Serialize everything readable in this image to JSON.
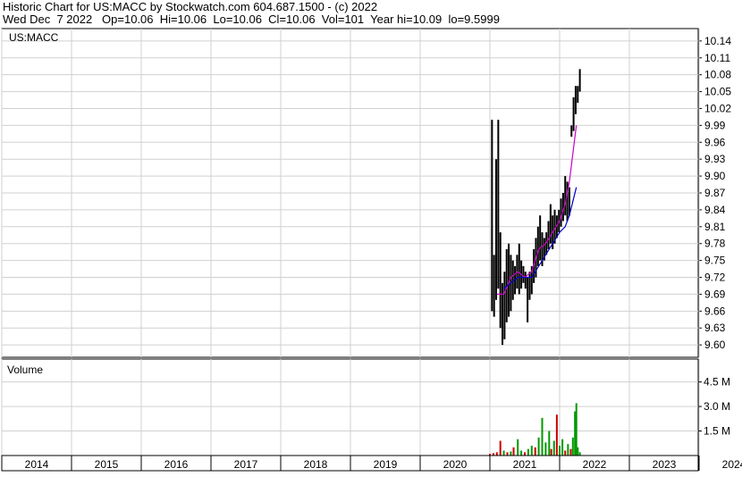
{
  "header": {
    "line1": "Historic Chart for US:MACC by Stockwatch.com 604.687.1500 - (c) 2022",
    "line2": "Wed Dec  7 2022   Op=10.06  Hi=10.06  Lo=10.06  Cl=10.06  Vol=101  Year hi=10.09  lo=9.5999"
  },
  "chart_data": [
    {
      "type": "candlestick",
      "title": "US:MACC",
      "y_ticks": [
        10.14,
        10.11,
        10.08,
        10.05,
        10.02,
        9.99,
        9.96,
        9.93,
        9.9,
        9.87,
        9.84,
        9.81,
        9.78,
        9.75,
        9.72,
        9.69,
        9.66,
        9.63,
        9.6
      ],
      "y_tick_labels": [
        "10.14",
        "10.11",
        "10.08",
        "10.05",
        "10.02",
        "9.99",
        "9.96",
        "9.93",
        "9.90",
        "9.87",
        "9.84",
        "9.81",
        "9.78",
        "9.75",
        "9.72",
        "9.69",
        "9.66",
        "9.63",
        "9.60"
      ],
      "ylim": [
        9.578,
        10.162
      ],
      "x_tick_labels": [
        "2014",
        "2015",
        "2016",
        "2017",
        "2018",
        "2019",
        "2020",
        "2021",
        "2022",
        "2023",
        "2024"
      ],
      "grid": true,
      "price_series": [
        {
          "t": 2021.03,
          "h": 10.0,
          "l": 9.66
        },
        {
          "t": 2021.06,
          "h": 9.76,
          "l": 9.65
        },
        {
          "t": 2021.09,
          "h": 9.93,
          "l": 9.68
        },
        {
          "t": 2021.12,
          "h": 10.0,
          "l": 9.7
        },
        {
          "t": 2021.15,
          "h": 9.8,
          "l": 9.63
        },
        {
          "t": 2021.18,
          "h": 9.71,
          "l": 9.6
        },
        {
          "t": 2021.21,
          "h": 9.73,
          "l": 9.61
        },
        {
          "t": 2021.24,
          "h": 9.77,
          "l": 9.64
        },
        {
          "t": 2021.27,
          "h": 9.78,
          "l": 9.65
        },
        {
          "t": 2021.3,
          "h": 9.76,
          "l": 9.66
        },
        {
          "t": 2021.33,
          "h": 9.75,
          "l": 9.68
        },
        {
          "t": 2021.36,
          "h": 9.74,
          "l": 9.69
        },
        {
          "t": 2021.39,
          "h": 9.76,
          "l": 9.7
        },
        {
          "t": 2021.42,
          "h": 9.78,
          "l": 9.69
        },
        {
          "t": 2021.45,
          "h": 9.75,
          "l": 9.7
        },
        {
          "t": 2021.48,
          "h": 9.74,
          "l": 9.71
        },
        {
          "t": 2021.51,
          "h": 9.73,
          "l": 9.7
        },
        {
          "t": 2021.54,
          "h": 9.72,
          "l": 9.64
        },
        {
          "t": 2021.57,
          "h": 9.73,
          "l": 9.68
        },
        {
          "t": 2021.6,
          "h": 9.74,
          "l": 9.69
        },
        {
          "t": 2021.63,
          "h": 9.77,
          "l": 9.71
        },
        {
          "t": 2021.66,
          "h": 9.79,
          "l": 9.72
        },
        {
          "t": 2021.69,
          "h": 9.81,
          "l": 9.74
        },
        {
          "t": 2021.72,
          "h": 9.83,
          "l": 9.75
        },
        {
          "t": 2021.75,
          "h": 9.8,
          "l": 9.74
        },
        {
          "t": 2021.78,
          "h": 9.79,
          "l": 9.75
        },
        {
          "t": 2021.81,
          "h": 9.8,
          "l": 9.76
        },
        {
          "t": 2021.84,
          "h": 9.82,
          "l": 9.77
        },
        {
          "t": 2021.87,
          "h": 9.85,
          "l": 9.78
        },
        {
          "t": 2021.9,
          "h": 9.83,
          "l": 9.77
        },
        {
          "t": 2021.93,
          "h": 9.84,
          "l": 9.78
        },
        {
          "t": 2021.96,
          "h": 9.83,
          "l": 9.79
        },
        {
          "t": 2021.99,
          "h": 9.84,
          "l": 9.8
        },
        {
          "t": 2022.02,
          "h": 9.86,
          "l": 9.81
        },
        {
          "t": 2022.05,
          "h": 9.87,
          "l": 9.82
        },
        {
          "t": 2022.08,
          "h": 9.9,
          "l": 9.83
        },
        {
          "t": 2022.11,
          "h": 9.89,
          "l": 9.82
        },
        {
          "t": 2022.14,
          "h": 9.88,
          "l": 9.83
        },
        {
          "t": 2022.17,
          "h": 9.99,
          "l": 9.97
        },
        {
          "t": 2022.2,
          "h": 10.04,
          "l": 9.98
        },
        {
          "t": 2022.23,
          "h": 10.06,
          "l": 10.01
        },
        {
          "t": 2022.26,
          "h": 10.06,
          "l": 10.03
        },
        {
          "t": 2022.29,
          "h": 10.09,
          "l": 10.05
        }
      ],
      "moving_averages": [
        {
          "color": "#cc00cc",
          "points": [
            [
              2021.1,
              9.69
            ],
            [
              2021.2,
              9.69
            ],
            [
              2021.3,
              9.72
            ],
            [
              2021.4,
              9.73
            ],
            [
              2021.5,
              9.72
            ],
            [
              2021.6,
              9.73
            ],
            [
              2021.7,
              9.77
            ],
            [
              2021.8,
              9.78
            ],
            [
              2021.9,
              9.8
            ],
            [
              2022.0,
              9.82
            ],
            [
              2022.08,
              9.85
            ],
            [
              2022.14,
              9.89
            ],
            [
              2022.2,
              9.95
            ],
            [
              2022.24,
              9.99
            ]
          ]
        },
        {
          "color": "#0000cc",
          "points": [
            [
              2021.2,
              9.7
            ],
            [
              2021.3,
              9.71
            ],
            [
              2021.4,
              9.72
            ],
            [
              2021.5,
              9.72
            ],
            [
              2021.6,
              9.72
            ],
            [
              2021.7,
              9.74
            ],
            [
              2021.8,
              9.76
            ],
            [
              2021.9,
              9.78
            ],
            [
              2022.0,
              9.8
            ],
            [
              2022.08,
              9.81
            ],
            [
              2022.14,
              9.83
            ],
            [
              2022.2,
              9.86
            ],
            [
              2022.24,
              9.88
            ]
          ]
        }
      ]
    },
    {
      "type": "bar",
      "title": "Volume",
      "y_tick_labels": [
        "4.5 M",
        "3.0 M",
        "1.5 M"
      ],
      "y_ticks": [
        4.5,
        3.0,
        1.5
      ],
      "ylim": [
        0,
        5.9
      ],
      "unit": "M",
      "bars": [
        {
          "t": 2021.0,
          "v": 0.1,
          "c": "#cc0000"
        },
        {
          "t": 2021.05,
          "v": 0.15,
          "c": "#cc0000"
        },
        {
          "t": 2021.1,
          "v": 0.2,
          "c": "#cc0000"
        },
        {
          "t": 2021.15,
          "v": 0.9,
          "c": "#cc0000"
        },
        {
          "t": 2021.2,
          "v": 0.3,
          "c": "#009900"
        },
        {
          "t": 2021.25,
          "v": 0.2,
          "c": "#cc0000"
        },
        {
          "t": 2021.3,
          "v": 0.25,
          "c": "#009900"
        },
        {
          "t": 2021.34,
          "v": 0.5,
          "c": "#cc0000"
        },
        {
          "t": 2021.4,
          "v": 1.0,
          "c": "#009900"
        },
        {
          "t": 2021.45,
          "v": 0.3,
          "c": "#009900"
        },
        {
          "t": 2021.5,
          "v": 0.2,
          "c": "#cc0000"
        },
        {
          "t": 2021.55,
          "v": 0.4,
          "c": "#009900"
        },
        {
          "t": 2021.6,
          "v": 0.6,
          "c": "#009900"
        },
        {
          "t": 2021.65,
          "v": 0.5,
          "c": "#cc0000"
        },
        {
          "t": 2021.7,
          "v": 1.1,
          "c": "#009900"
        },
        {
          "t": 2021.75,
          "v": 2.3,
          "c": "#009900"
        },
        {
          "t": 2021.8,
          "v": 0.8,
          "c": "#009900"
        },
        {
          "t": 2021.85,
          "v": 1.5,
          "c": "#009900"
        },
        {
          "t": 2021.88,
          "v": 0.4,
          "c": "#cc0000"
        },
        {
          "t": 2021.92,
          "v": 0.9,
          "c": "#009900"
        },
        {
          "t": 2021.96,
          "v": 2.5,
          "c": "#cc0000"
        },
        {
          "t": 2022.0,
          "v": 0.6,
          "c": "#009900"
        },
        {
          "t": 2022.04,
          "v": 1.0,
          "c": "#009900"
        },
        {
          "t": 2022.08,
          "v": 0.3,
          "c": "#cc0000"
        },
        {
          "t": 2022.12,
          "v": 0.7,
          "c": "#009900"
        },
        {
          "t": 2022.16,
          "v": 0.4,
          "c": "#cc0000"
        },
        {
          "t": 2022.19,
          "v": 1.1,
          "c": "#009900"
        },
        {
          "t": 2022.22,
          "v": 2.7,
          "c": "#009900"
        },
        {
          "t": 2022.24,
          "v": 3.2,
          "c": "#009900"
        },
        {
          "t": 2022.26,
          "v": 0.5,
          "c": "#009900"
        },
        {
          "t": 2022.29,
          "v": 0.2,
          "c": "#009900"
        }
      ]
    }
  ]
}
